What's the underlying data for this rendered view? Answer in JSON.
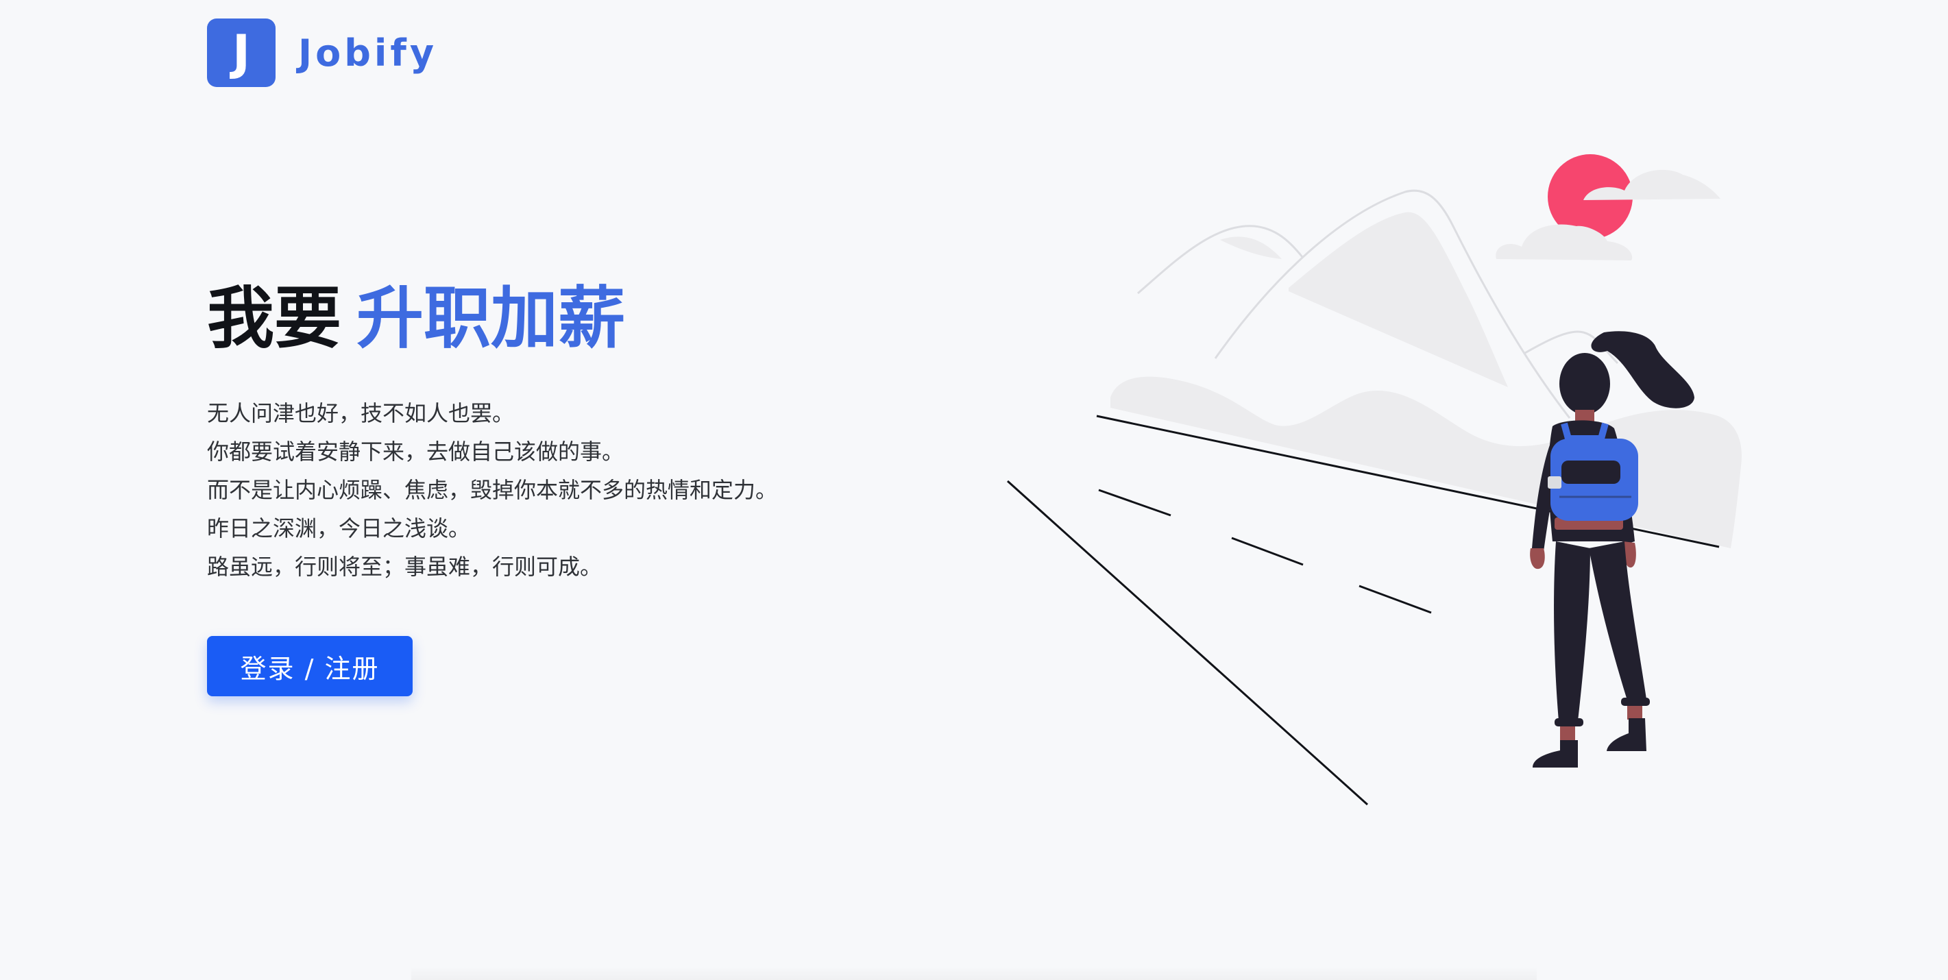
{
  "brand": {
    "logo_letter": "J",
    "name": "Jobify",
    "color": "#3e6be0"
  },
  "hero": {
    "title_plain": "我要",
    "title_accent": "升职加薪",
    "lines": [
      "无人问津也好，技不如人也罢。",
      "你都要试着安静下来，去做自己该做的事。",
      "而不是让内心烦躁、焦虑，毁掉你本就不多的热情和定力。",
      "昨日之深渊，今日之浅谈。",
      "路虽远，行则将至；事虽难，行则可成。"
    ],
    "cta_label": "登录 / 注册",
    "cta_color": "#1a5cf5"
  },
  "illustration": {
    "subject": "woman-with-backpack-looking-at-mountains",
    "sun_color": "#f6466e",
    "backpack_color": "#3e6be0",
    "figure_color": "#22202e"
  }
}
